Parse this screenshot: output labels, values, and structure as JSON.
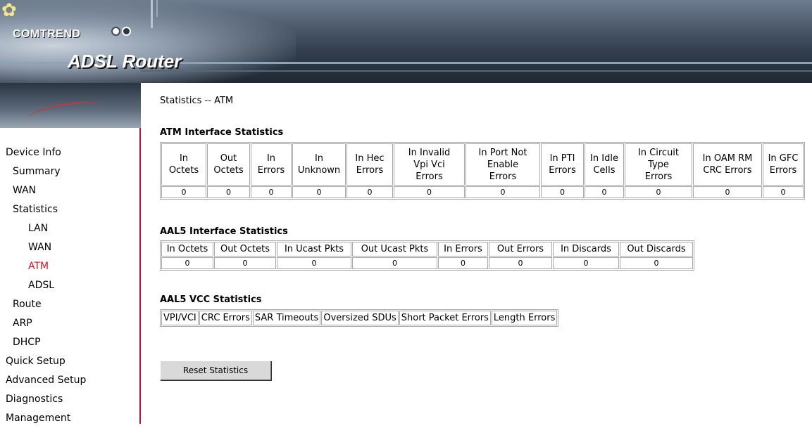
{
  "brand": {
    "company": "COMTREND",
    "product": "ADSL Router"
  },
  "nav": [
    {
      "label": "Device Info",
      "level": 1,
      "active": false
    },
    {
      "label": "Summary",
      "level": 2,
      "active": false
    },
    {
      "label": "WAN",
      "level": 2,
      "active": false
    },
    {
      "label": "Statistics",
      "level": 2,
      "active": false
    },
    {
      "label": "LAN",
      "level": 3,
      "active": false
    },
    {
      "label": "WAN",
      "level": 3,
      "active": false
    },
    {
      "label": "ATM",
      "level": 3,
      "active": true
    },
    {
      "label": "ADSL",
      "level": 3,
      "active": false
    },
    {
      "label": "Route",
      "level": 2,
      "active": false
    },
    {
      "label": "ARP",
      "level": 2,
      "active": false
    },
    {
      "label": "DHCP",
      "level": 2,
      "active": false
    },
    {
      "label": "Quick Setup",
      "level": 1,
      "active": false
    },
    {
      "label": "Advanced Setup",
      "level": 1,
      "active": false
    },
    {
      "label": "Diagnostics",
      "level": 1,
      "active": false
    },
    {
      "label": "Management",
      "level": 1,
      "active": false
    }
  ],
  "page": {
    "title": "Statistics -- ATM"
  },
  "atm_stats": {
    "title": "ATM Interface Statistics",
    "headers": [
      [
        "In",
        "Octets"
      ],
      [
        "Out",
        "Octets"
      ],
      [
        "In",
        "Errors"
      ],
      [
        "In",
        "Unknown"
      ],
      [
        "In Hec",
        "Errors"
      ],
      [
        "In Invalid",
        "Vpi Vci",
        "Errors"
      ],
      [
        "In Port Not",
        "Enable",
        "Errors"
      ],
      [
        "In PTI",
        "Errors"
      ],
      [
        "In Idle",
        "Cells"
      ],
      [
        "In Circuit",
        "Type",
        "Errors"
      ],
      [
        "In OAM RM",
        "CRC Errors"
      ],
      [
        "In GFC",
        "Errors"
      ]
    ],
    "values": [
      "0",
      "0",
      "0",
      "0",
      "0",
      "0",
      "0",
      "0",
      "0",
      "0",
      "0",
      "0"
    ]
  },
  "aal5_stats": {
    "title": "AAL5 Interface Statistics",
    "headers": [
      "In Octets",
      "Out Octets",
      "In Ucast Pkts",
      "Out Ucast Pkts",
      "In Errors",
      "Out Errors",
      "In Discards",
      "Out Discards"
    ],
    "values": [
      "0",
      "0",
      "0",
      "0",
      "0",
      "0",
      "0",
      "0"
    ]
  },
  "vcc_stats": {
    "title": "AAL5 VCC Statistics",
    "headers": [
      "VPI/VCI",
      "CRC Errors",
      "SAR Timeouts",
      "Oversized SDUs",
      "Short Packet Errors",
      "Length Errors"
    ]
  },
  "reset_button": {
    "label": "Reset Statistics"
  },
  "colors": {
    "active_nav": "#e01020",
    "sidebar_border": "#c0143c",
    "table_border": "#a9a9a9"
  }
}
